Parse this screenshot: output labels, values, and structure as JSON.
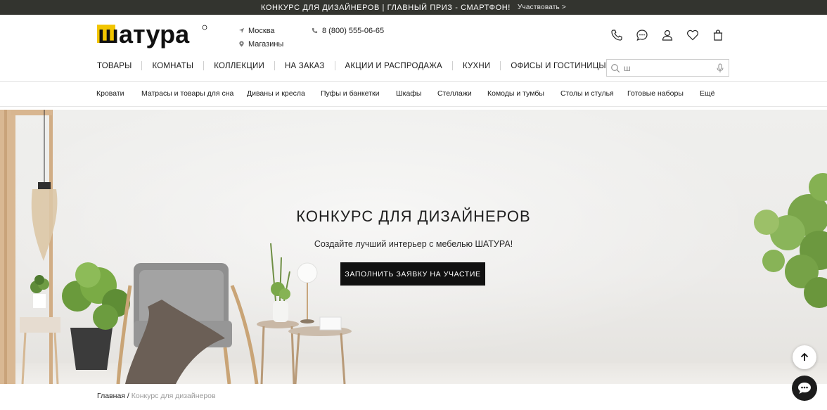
{
  "promo": {
    "text": "КОНКУРС ДЛЯ ДИЗАЙНЕРОВ | ГЛАВНЫЙ ПРИЗ - СМАРТФОН!",
    "link": "Участвовать >"
  },
  "header": {
    "logo_text": "шатура",
    "city": "Москва",
    "stores": "Магазины",
    "phone": "8 (800) 555-06-65",
    "icons": [
      "phone-icon",
      "chat-icon",
      "user-icon",
      "heart-icon",
      "bag-icon"
    ]
  },
  "main_nav": [
    "ТОВАРЫ",
    "КОМНАТЫ",
    "КОЛЛЕКЦИИ",
    "НА ЗАКАЗ",
    "АКЦИИ И РАСПРОДАЖА",
    "КУХНИ",
    "ОФИСЫ И ГОСТИНИЦЫ"
  ],
  "search": {
    "value": "ш"
  },
  "categories": [
    "Кровати",
    "Матрасы и товары для сна",
    "Диваны и кресла",
    "Пуфы и банкетки",
    "Шкафы",
    "Стеллажи",
    "Комоды и тумбы",
    "Столы и стулья",
    "Готовые наборы",
    "Ещё"
  ],
  "hero": {
    "title": "КОНКУРС ДЛЯ ДИЗАЙНЕРОВ",
    "subtitle": "Создайте лучший интерьер с мебелью ШАТУРА!",
    "button": "ЗАПОЛНИТЬ ЗАЯВКУ НА УЧАСТИЕ"
  },
  "breadcrumb": {
    "home": "Главная",
    "separator": "/",
    "current": "Конкурс для дизайнеров"
  },
  "colors": {
    "promo_bg": "#33342f",
    "logo_yellow": "#f2c500",
    "button_bg": "#111111"
  }
}
